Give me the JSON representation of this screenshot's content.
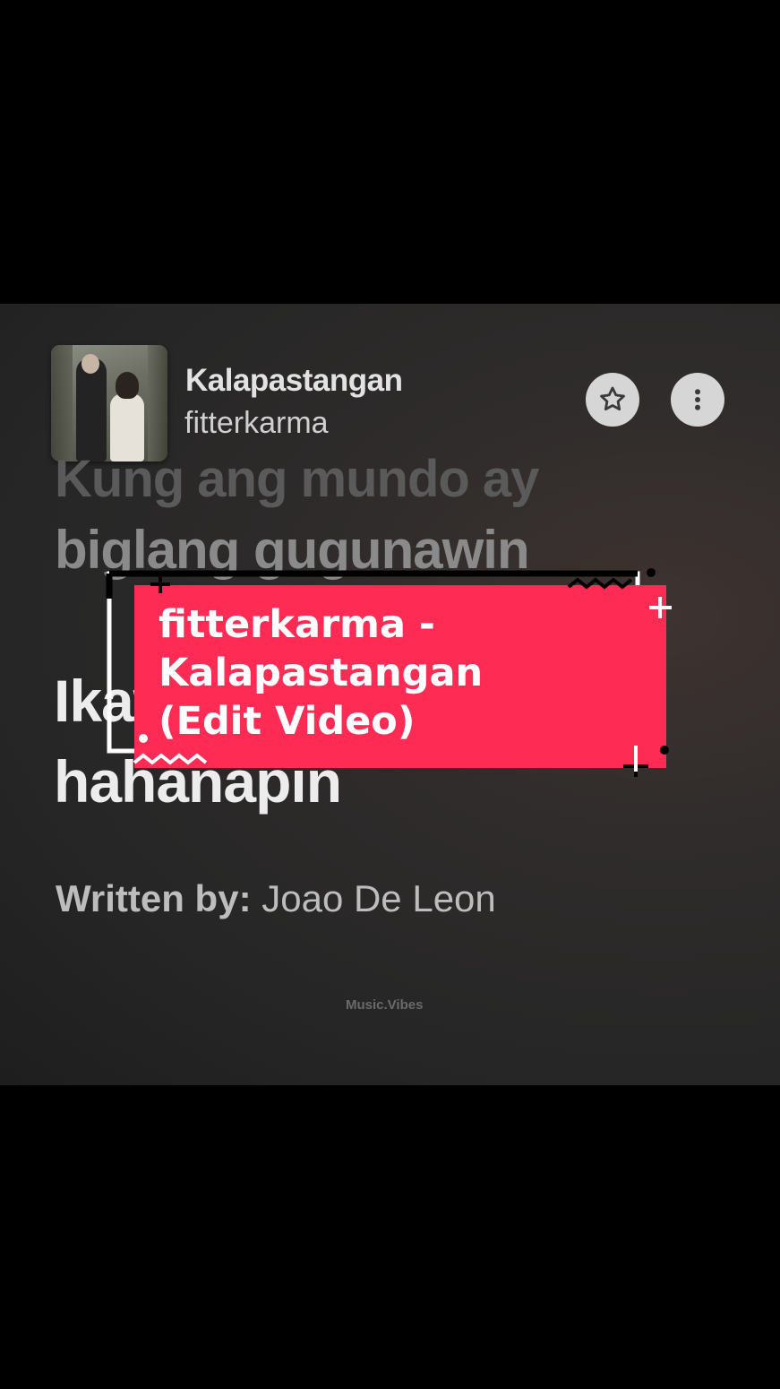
{
  "now_playing": {
    "title": "Kalapastangan",
    "artist": "fitterkarma"
  },
  "lyrics": {
    "faded_line": "Kung ang mundo ay",
    "previous_line": "biglang gugunawin",
    "current_line_1": "Ikaw pa rin ang",
    "current_line_2": "hahanapin"
  },
  "credits": {
    "label": "Written by:",
    "writer": "Joao De Leon"
  },
  "watermark": "Music.Vibes",
  "overlay": {
    "line1": "fitterkarma -",
    "line2": "Kalapastangan",
    "line3": "(Edit Video)",
    "color": "#fe2c55"
  },
  "icons": {
    "favorite": "star-icon",
    "more": "more-vertical-icon"
  }
}
